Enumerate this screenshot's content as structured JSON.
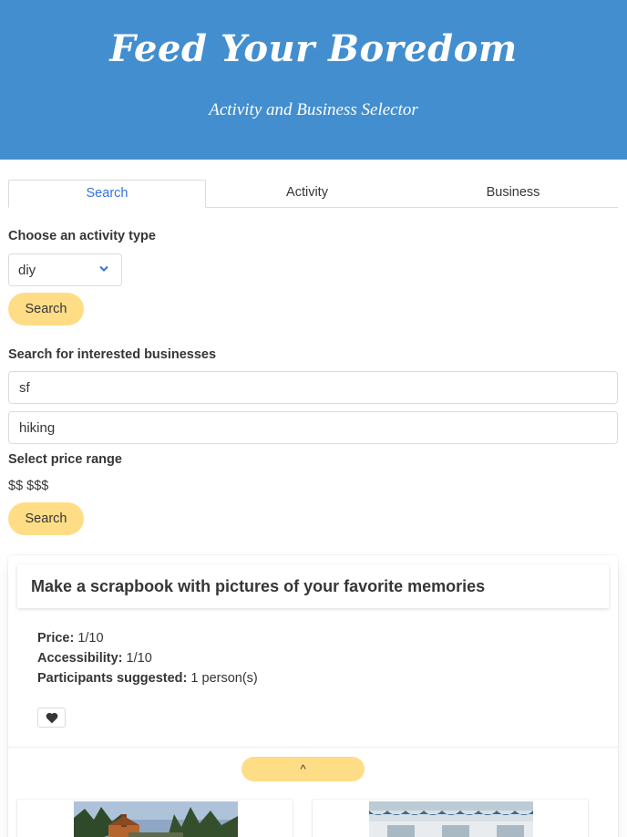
{
  "header": {
    "title": "Feed Your Boredom",
    "subtitle": "Activity and Business Selector",
    "background": "#428ecf"
  },
  "tabs": [
    {
      "label": "Search",
      "active": true
    },
    {
      "label": "Activity",
      "active": false
    },
    {
      "label": "Business",
      "active": false
    }
  ],
  "activity_search": {
    "label": "Choose an activity type",
    "selected": "diy",
    "button_label": "Search"
  },
  "business_search": {
    "label": "Search for interested businesses",
    "location_value": "sf",
    "term_value": "hiking",
    "price_label": "Select price range",
    "price_options": "$$ $$$",
    "button_label": "Search"
  },
  "result_card": {
    "title": "Make a scrapbook with pictures of your favorite memories",
    "price_label": "Price:",
    "price_value": "1/10",
    "accessibility_label": "Accessibility:",
    "accessibility_value": "1/10",
    "participants_label": "Participants suggested:",
    "participants_value": "1 person(s)",
    "favorite_icon": "heart-icon",
    "collapse_label": "^"
  },
  "colors": {
    "accent_button": "#ffdd86",
    "link": "#3273dc",
    "text": "#363636"
  }
}
